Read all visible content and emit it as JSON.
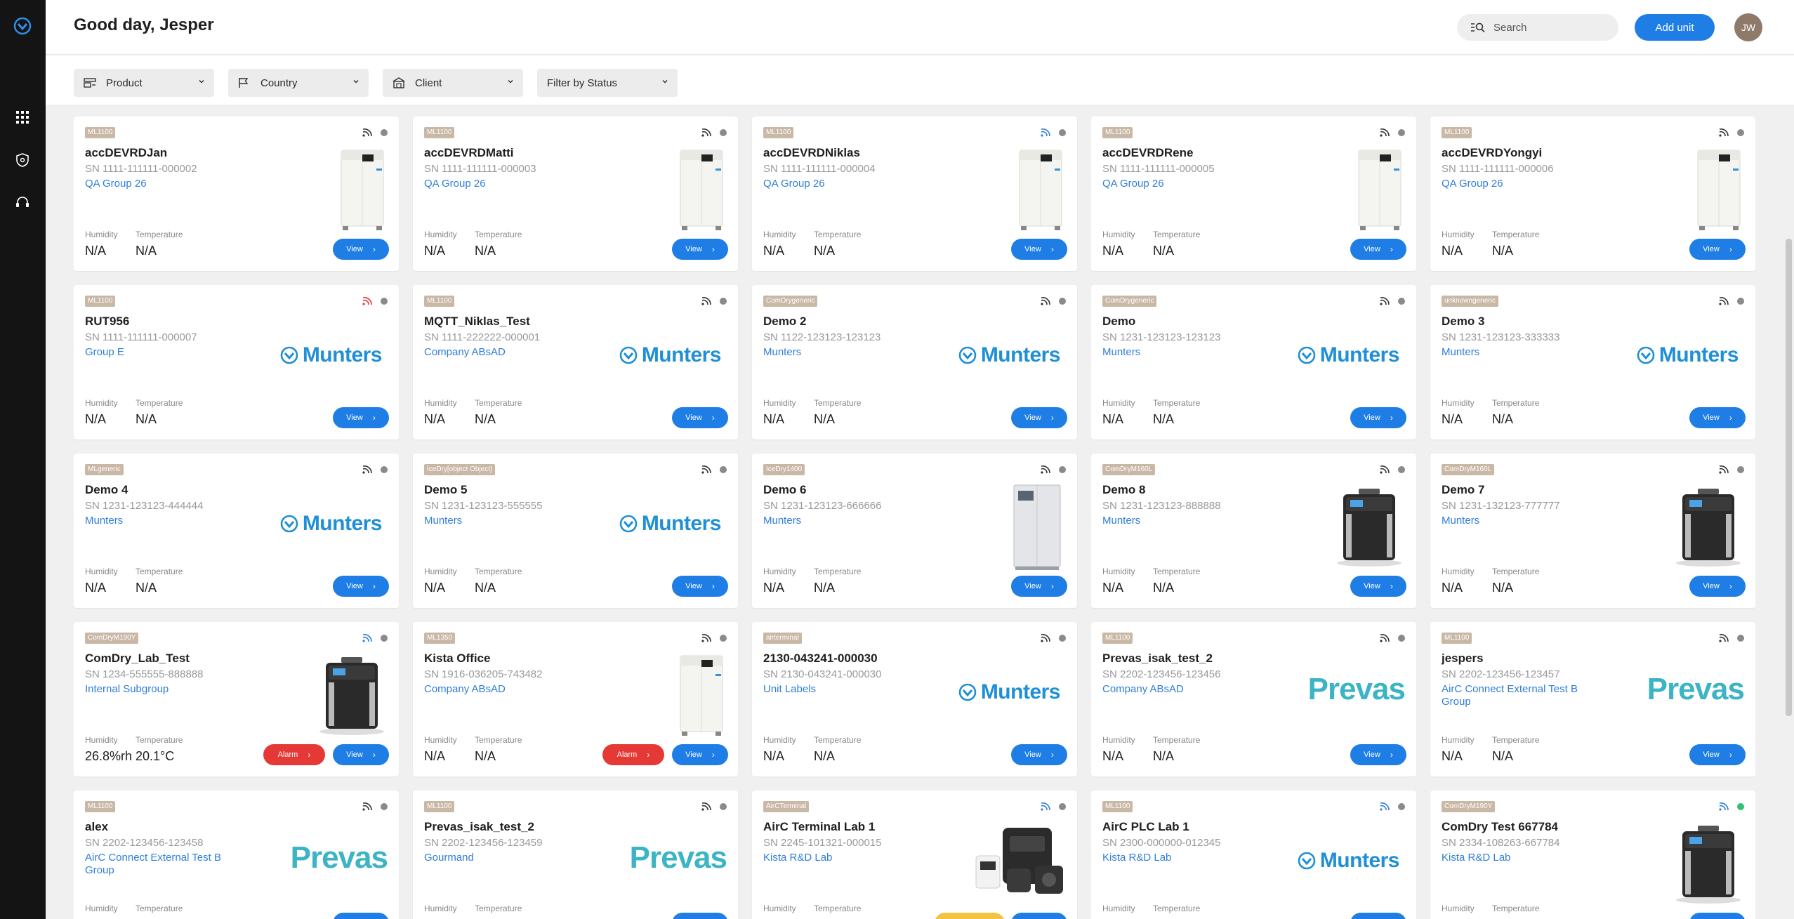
{
  "header": {
    "greeting": "Good day, Jesper",
    "search_placeholder": "Search",
    "add_unit_label": "Add unit",
    "avatar_initials": "JW"
  },
  "sidebar": {
    "items": [
      {
        "name": "munters-logo-icon"
      },
      {
        "name": "apps-grid-icon"
      },
      {
        "name": "shield-icon"
      },
      {
        "name": "support-headset-icon"
      }
    ]
  },
  "filters": [
    {
      "label": "Product",
      "icon": "product-icon"
    },
    {
      "label": "Country",
      "icon": "flag-icon"
    },
    {
      "label": "Client",
      "icon": "building-icon"
    },
    {
      "label": "Filter by Status",
      "icon": ""
    }
  ],
  "labels": {
    "humidity": "Humidity",
    "temperature": "Temperature",
    "view": "View",
    "alarm": "Alarm"
  },
  "colors": {
    "accent": "#1e7ee6",
    "alarm": "#e53935",
    "signal_normal": "#333333",
    "signal_active": "#2f7ed8",
    "signal_error": "#e53935",
    "status_online": "#2ec276",
    "status_offline": "#8a8a8a"
  },
  "cards": [
    {
      "tag": "ML1100",
      "name": "accDEVRDJan",
      "sn": "SN 1111-111111-000002",
      "group": "QA Group 26",
      "image": "ml1100",
      "signal": "normal",
      "status": "offline",
      "humidity": "N/A",
      "temperature": "N/A",
      "alarm": false
    },
    {
      "tag": "ML1100",
      "name": "accDEVRDMatti",
      "sn": "SN 1111-111111-000003",
      "group": "QA Group 26",
      "image": "ml1100",
      "signal": "normal",
      "status": "offline",
      "humidity": "N/A",
      "temperature": "N/A",
      "alarm": false
    },
    {
      "tag": "ML1100",
      "name": "accDEVRDNiklas",
      "sn": "SN 1111-111111-000004",
      "group": "QA Group 26",
      "image": "ml1100",
      "signal": "active",
      "status": "offline",
      "humidity": "N/A",
      "temperature": "N/A",
      "alarm": false
    },
    {
      "tag": "ML1100",
      "name": "accDEVRDRene",
      "sn": "SN 1111-111111-000005",
      "group": "QA Group 26",
      "image": "ml1100",
      "signal": "normal",
      "status": "offline",
      "humidity": "N/A",
      "temperature": "N/A",
      "alarm": false
    },
    {
      "tag": "ML1100",
      "name": "accDEVRDYongyi",
      "sn": "SN 1111-111111-000006",
      "group": "QA Group 26",
      "image": "ml1100",
      "signal": "normal",
      "status": "offline",
      "humidity": "N/A",
      "temperature": "N/A",
      "alarm": false
    },
    {
      "tag": "ML1100",
      "name": "RUT956",
      "sn": "SN 1111-111111-000007",
      "group": "Group E",
      "image": "munters",
      "signal": "error",
      "status": "offline",
      "humidity": "N/A",
      "temperature": "N/A",
      "alarm": false
    },
    {
      "tag": "ML1100",
      "name": "MQTT_Niklas_Test",
      "sn": "SN 1111-222222-000001",
      "group": "Company ABsAD",
      "image": "munters",
      "signal": "normal",
      "status": "offline",
      "humidity": "N/A",
      "temperature": "N/A",
      "alarm": false
    },
    {
      "tag": "ComDrygeneric",
      "name": "Demo 2",
      "sn": "SN 1122-123123-123123",
      "group": "Munters",
      "image": "munters",
      "signal": "normal",
      "status": "offline",
      "humidity": "N/A",
      "temperature": "N/A",
      "alarm": false
    },
    {
      "tag": "ComDrygeneric",
      "name": "Demo",
      "sn": "SN 1231-123123-123123",
      "group": "Munters",
      "image": "munters",
      "signal": "normal",
      "status": "offline",
      "humidity": "N/A",
      "temperature": "N/A",
      "alarm": false
    },
    {
      "tag": "unknowngeneric",
      "name": "Demo 3",
      "sn": "SN 1231-123123-333333",
      "group": "Munters",
      "image": "munters",
      "signal": "normal",
      "status": "offline",
      "humidity": "N/A",
      "temperature": "N/A",
      "alarm": false
    },
    {
      "tag": "MLgeneric",
      "name": "Demo 4",
      "sn": "SN 1231-123123-444444",
      "group": "Munters",
      "image": "munters",
      "signal": "normal",
      "status": "offline",
      "humidity": "N/A",
      "temperature": "N/A",
      "alarm": false
    },
    {
      "tag": "IceDry[object Object]",
      "name": "Demo 5",
      "sn": "SN 1231-123123-555555",
      "group": "Munters",
      "image": "munters",
      "signal": "normal",
      "status": "offline",
      "humidity": "N/A",
      "temperature": "N/A",
      "alarm": false
    },
    {
      "tag": "IceDry1400",
      "name": "Demo 6",
      "sn": "SN 1231-123123-666666",
      "group": "Munters",
      "image": "icedry",
      "signal": "normal",
      "status": "offline",
      "humidity": "N/A",
      "temperature": "N/A",
      "alarm": false
    },
    {
      "tag": "ComDryM160L",
      "name": "Demo 8",
      "sn": "SN 1231-123123-888888",
      "group": "Munters",
      "image": "comdry",
      "signal": "normal",
      "status": "offline",
      "humidity": "N/A",
      "temperature": "N/A",
      "alarm": false
    },
    {
      "tag": "ComDryM160L",
      "name": "Demo 7",
      "sn": "SN 1231-132123-777777",
      "group": "Munters",
      "image": "comdry",
      "signal": "normal",
      "status": "offline",
      "humidity": "N/A",
      "temperature": "N/A",
      "alarm": false
    },
    {
      "tag": "ComDryM190Y",
      "name": "ComDry_Lab_Test",
      "sn": "SN 1234-555555-888888",
      "group": "Internal Subgroup",
      "image": "comdry",
      "signal": "active",
      "status": "offline",
      "humidity": "26.8%rh",
      "temperature": "20.1°C",
      "alarm": true
    },
    {
      "tag": "ML1350",
      "name": "Kista Office",
      "sn": "SN 1916-036205-743482",
      "group": "Company ABsAD",
      "image": "ml1100",
      "signal": "normal",
      "status": "offline",
      "humidity": "N/A",
      "temperature": "N/A",
      "alarm": true
    },
    {
      "tag": "airterminal",
      "name": "2130-043241-000030",
      "sn": "SN 2130-043241-000030",
      "group": "Unit Labels",
      "image": "munters",
      "signal": "normal",
      "status": "offline",
      "humidity": "N/A",
      "temperature": "N/A",
      "alarm": false
    },
    {
      "tag": "ML1100",
      "name": "Prevas_isak_test_2",
      "sn": "SN 2202-123456-123456",
      "group": "Company ABsAD",
      "image": "prevas",
      "signal": "normal",
      "status": "offline",
      "humidity": "N/A",
      "temperature": "N/A",
      "alarm": false
    },
    {
      "tag": "ML1100",
      "name": "jespers",
      "sn": "SN 2202-123456-123457",
      "group": "AirC Connect External Test B Group",
      "image": "prevas",
      "signal": "normal",
      "status": "offline",
      "humidity": "N/A",
      "temperature": "N/A",
      "alarm": false
    },
    {
      "tag": "ML1100",
      "name": "alex",
      "sn": "SN 2202-123456-123458",
      "group": "AirC Connect External Test B Group",
      "image": "prevas",
      "signal": "normal",
      "status": "offline",
      "humidity": "",
      "temperature": "",
      "alarm": false
    },
    {
      "tag": "ML1100",
      "name": "Prevas_isak_test_2",
      "sn": "SN 2202-123456-123459",
      "group": "Gourmand",
      "image": "prevas",
      "signal": "normal",
      "status": "offline",
      "humidity": "",
      "temperature": "",
      "alarm": false
    },
    {
      "tag": "AirCTerminal",
      "name": "AirC Terminal Lab 1",
      "sn": "SN 2245-101321-000015",
      "group": "Kista R&D Lab",
      "image": "terminal",
      "signal": "active",
      "status": "offline",
      "humidity": "",
      "temperature": "",
      "alarm": false,
      "warning": true
    },
    {
      "tag": "ML1100",
      "name": "AirC PLC Lab 1",
      "sn": "SN 2300-000000-012345",
      "group": "Kista R&D Lab",
      "image": "munters",
      "signal": "active",
      "status": "offline",
      "humidity": "",
      "temperature": "",
      "alarm": false
    },
    {
      "tag": "ComDryM190Y",
      "name": "ComDry Test 667784",
      "sn": "SN 2334-108263-667784",
      "group": "Kista R&D Lab",
      "image": "comdry",
      "signal": "active",
      "status": "online",
      "humidity": "",
      "temperature": "",
      "alarm": false
    }
  ],
  "brand_text": {
    "munters": "Munters",
    "prevas": "Prevas"
  }
}
